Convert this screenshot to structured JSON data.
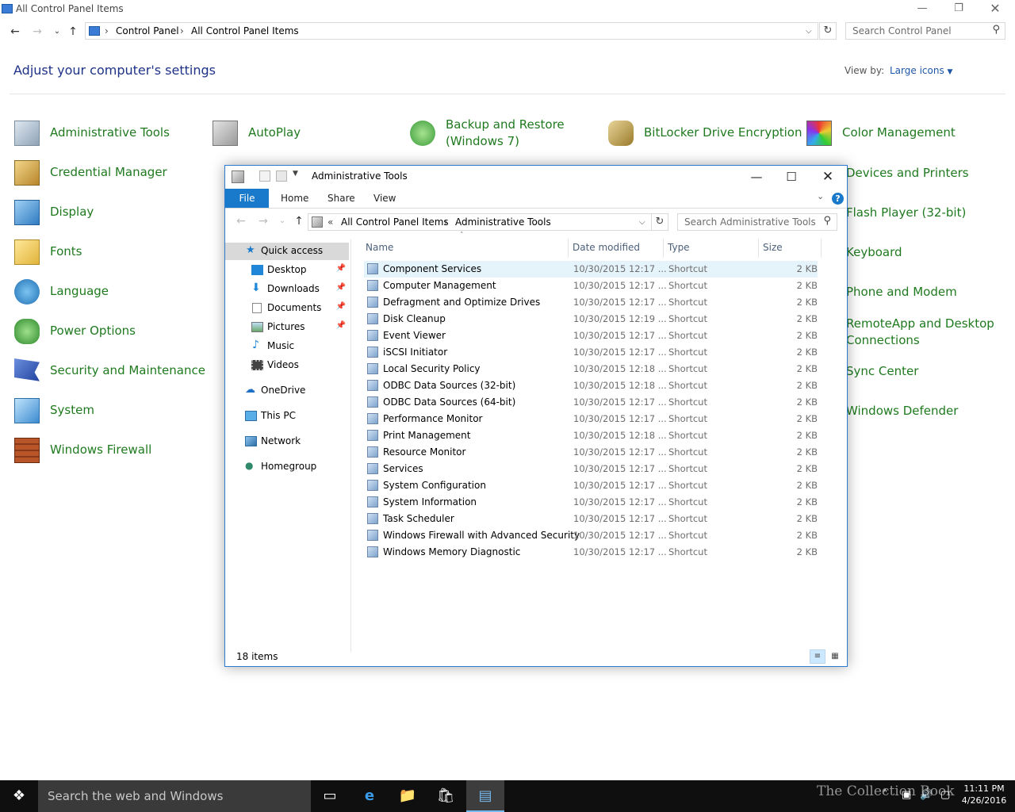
{
  "cp": {
    "title": "All Control Panel Items",
    "breadcrumb": [
      "Control Panel",
      "All Control Panel Items"
    ],
    "search_placeholder": "Search Control Panel",
    "heading": "Adjust your computer's settings",
    "viewby_label": "View by:",
    "viewby_value": "Large icons",
    "items_col1": [
      "Administrative Tools",
      "Credential Manager",
      "Display",
      "Fonts",
      "Language",
      "Power Options",
      "Security and Maintenance",
      "System",
      "Windows Firewall"
    ],
    "items_top": [
      "AutoPlay",
      "Backup and Restore",
      "(Windows 7)",
      "BitLocker Drive Encryption",
      "Color Management"
    ],
    "items_col5": [
      "Devices and Printers",
      "Flash Player (32-bit)",
      "Keyboard",
      "Phone and Modem",
      "RemoteApp and Desktop",
      "Connections",
      "Sync Center",
      "Windows Defender"
    ]
  },
  "explorer": {
    "title": "Administrative Tools",
    "tabs": [
      "File",
      "Home",
      "Share",
      "View"
    ],
    "address": {
      "prefix": "«",
      "parts": [
        "All Control Panel Items",
        "Administrative Tools"
      ]
    },
    "search_placeholder": "Search Administrative Tools",
    "nav": [
      {
        "label": "Quick access",
        "pinned": false
      },
      {
        "label": "Desktop",
        "pinned": true
      },
      {
        "label": "Downloads",
        "pinned": true
      },
      {
        "label": "Documents",
        "pinned": true
      },
      {
        "label": "Pictures",
        "pinned": true
      },
      {
        "label": "Music",
        "pinned": false
      },
      {
        "label": "Videos",
        "pinned": false
      },
      {
        "label": "OneDrive",
        "pinned": false
      },
      {
        "label": "This PC",
        "pinned": false
      },
      {
        "label": "Network",
        "pinned": false
      },
      {
        "label": "Homegroup",
        "pinned": false
      }
    ],
    "columns": [
      "Name",
      "Date modified",
      "Type",
      "Size"
    ],
    "files": [
      {
        "name": "Component Services",
        "date": "10/30/2015 12:17 ...",
        "type": "Shortcut",
        "size": "2 KB"
      },
      {
        "name": "Computer Management",
        "date": "10/30/2015 12:17 ...",
        "type": "Shortcut",
        "size": "2 KB"
      },
      {
        "name": "Defragment and Optimize Drives",
        "date": "10/30/2015 12:17 ...",
        "type": "Shortcut",
        "size": "2 KB"
      },
      {
        "name": "Disk Cleanup",
        "date": "10/30/2015 12:19 ...",
        "type": "Shortcut",
        "size": "2 KB"
      },
      {
        "name": "Event Viewer",
        "date": "10/30/2015 12:17 ...",
        "type": "Shortcut",
        "size": "2 KB"
      },
      {
        "name": "iSCSI Initiator",
        "date": "10/30/2015 12:17 ...",
        "type": "Shortcut",
        "size": "2 KB"
      },
      {
        "name": "Local Security Policy",
        "date": "10/30/2015 12:18 ...",
        "type": "Shortcut",
        "size": "2 KB"
      },
      {
        "name": "ODBC Data Sources (32-bit)",
        "date": "10/30/2015 12:18 ...",
        "type": "Shortcut",
        "size": "2 KB"
      },
      {
        "name": "ODBC Data Sources (64-bit)",
        "date": "10/30/2015 12:17 ...",
        "type": "Shortcut",
        "size": "2 KB"
      },
      {
        "name": "Performance Monitor",
        "date": "10/30/2015 12:17 ...",
        "type": "Shortcut",
        "size": "2 KB"
      },
      {
        "name": "Print Management",
        "date": "10/30/2015 12:18 ...",
        "type": "Shortcut",
        "size": "2 KB"
      },
      {
        "name": "Resource Monitor",
        "date": "10/30/2015 12:17 ...",
        "type": "Shortcut",
        "size": "2 KB"
      },
      {
        "name": "Services",
        "date": "10/30/2015 12:17 ...",
        "type": "Shortcut",
        "size": "2 KB"
      },
      {
        "name": "System Configuration",
        "date": "10/30/2015 12:17 ...",
        "type": "Shortcut",
        "size": "2 KB"
      },
      {
        "name": "System Information",
        "date": "10/30/2015 12:17 ...",
        "type": "Shortcut",
        "size": "2 KB"
      },
      {
        "name": "Task Scheduler",
        "date": "10/30/2015 12:17 ...",
        "type": "Shortcut",
        "size": "2 KB"
      },
      {
        "name": "Windows Firewall with Advanced Security",
        "date": "10/30/2015 12:17 ...",
        "type": "Shortcut",
        "size": "2 KB"
      },
      {
        "name": "Windows Memory Diagnostic",
        "date": "10/30/2015 12:17 ...",
        "type": "Shortcut",
        "size": "2 KB"
      }
    ],
    "status": "18 items"
  },
  "taskbar": {
    "search_placeholder": "Search the web and Windows",
    "time": "11:11 PM",
    "date": "4/26/2016",
    "watermark": "The Collection Book"
  },
  "colors": {
    "accent": "#1979ca",
    "link_green": "#1f7a1f",
    "heading_blue": "#1e3287",
    "taskbar": "#0f0f0f"
  }
}
